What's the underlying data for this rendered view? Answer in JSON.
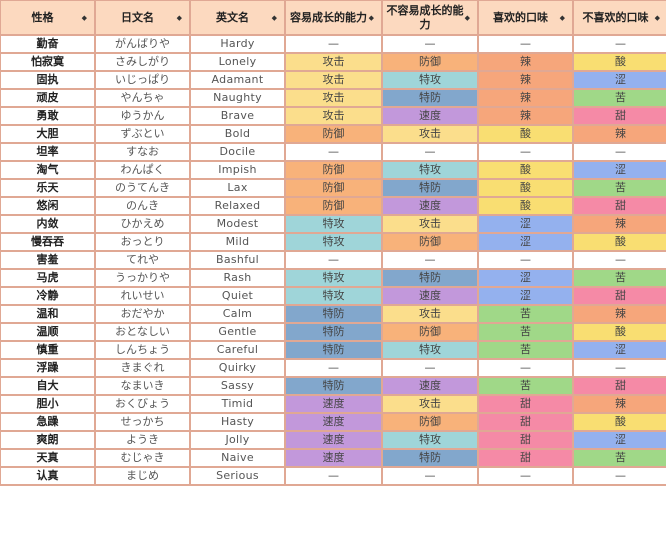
{
  "table": {
    "headers": [
      {
        "label": "性格",
        "sort_icon": "sort-diamond-icon"
      },
      {
        "label": "日文名",
        "sort_icon": "sort-diamond-icon"
      },
      {
        "label": "英文名",
        "sort_icon": "sort-diamond-icon"
      },
      {
        "label": "容易成长的能力",
        "sort_icon": "sort-diamond-icon"
      },
      {
        "label": "不容易成长的能力",
        "sort_icon": "sort-diamond-icon"
      },
      {
        "label": "喜欢的口味",
        "sort_icon": "sort-diamond-icon"
      },
      {
        "label": "不喜欢的口味",
        "sort_icon": "sort-diamond-icon"
      }
    ],
    "rows": [
      {
        "nature": "勤奋",
        "jp": "がんばりや",
        "en": "Hardy",
        "up": "—",
        "down": "—",
        "like": "—",
        "dislike": "—"
      },
      {
        "nature": "怕寂寞",
        "jp": "さみしがり",
        "en": "Lonely",
        "up": "攻击",
        "down": "防御",
        "like": "辣",
        "dislike": "酸"
      },
      {
        "nature": "固执",
        "jp": "いじっぱり",
        "en": "Adamant",
        "up": "攻击",
        "down": "特攻",
        "like": "辣",
        "dislike": "涩"
      },
      {
        "nature": "顽皮",
        "jp": "やんちゃ",
        "en": "Naughty",
        "up": "攻击",
        "down": "特防",
        "like": "辣",
        "dislike": "苦"
      },
      {
        "nature": "勇敢",
        "jp": "ゆうかん",
        "en": "Brave",
        "up": "攻击",
        "down": "速度",
        "like": "辣",
        "dislike": "甜"
      },
      {
        "nature": "大胆",
        "jp": "ずぶとい",
        "en": "Bold",
        "up": "防御",
        "down": "攻击",
        "like": "酸",
        "dislike": "辣"
      },
      {
        "nature": "坦率",
        "jp": "すなお",
        "en": "Docile",
        "up": "—",
        "down": "—",
        "like": "—",
        "dislike": "—"
      },
      {
        "nature": "淘气",
        "jp": "わんぱく",
        "en": "Impish",
        "up": "防御",
        "down": "特攻",
        "like": "酸",
        "dislike": "涩"
      },
      {
        "nature": "乐天",
        "jp": "のうてんき",
        "en": "Lax",
        "up": "防御",
        "down": "特防",
        "like": "酸",
        "dislike": "苦"
      },
      {
        "nature": "悠闲",
        "jp": "のんき",
        "en": "Relaxed",
        "up": "防御",
        "down": "速度",
        "like": "酸",
        "dislike": "甜"
      },
      {
        "nature": "内敛",
        "jp": "ひかえめ",
        "en": "Modest",
        "up": "特攻",
        "down": "攻击",
        "like": "涩",
        "dislike": "辣"
      },
      {
        "nature": "慢吞吞",
        "jp": "おっとり",
        "en": "Mild",
        "up": "特攻",
        "down": "防御",
        "like": "涩",
        "dislike": "酸"
      },
      {
        "nature": "害羞",
        "jp": "てれや",
        "en": "Bashful",
        "up": "—",
        "down": "—",
        "like": "—",
        "dislike": "—"
      },
      {
        "nature": "马虎",
        "jp": "うっかりや",
        "en": "Rash",
        "up": "特攻",
        "down": "特防",
        "like": "涩",
        "dislike": "苦"
      },
      {
        "nature": "冷静",
        "jp": "れいせい",
        "en": "Quiet",
        "up": "特攻",
        "down": "速度",
        "like": "涩",
        "dislike": "甜"
      },
      {
        "nature": "温和",
        "jp": "おだやか",
        "en": "Calm",
        "up": "特防",
        "down": "攻击",
        "like": "苦",
        "dislike": "辣"
      },
      {
        "nature": "温顺",
        "jp": "おとなしい",
        "en": "Gentle",
        "up": "特防",
        "down": "防御",
        "like": "苦",
        "dislike": "酸"
      },
      {
        "nature": "慎重",
        "jp": "しんちょう",
        "en": "Careful",
        "up": "特防",
        "down": "特攻",
        "like": "苦",
        "dislike": "涩"
      },
      {
        "nature": "浮躁",
        "jp": "きまぐれ",
        "en": "Quirky",
        "up": "—",
        "down": "—",
        "like": "—",
        "dislike": "—"
      },
      {
        "nature": "自大",
        "jp": "なまいき",
        "en": "Sassy",
        "up": "特防",
        "down": "速度",
        "like": "苦",
        "dislike": "甜"
      },
      {
        "nature": "胆小",
        "jp": "おくびょう",
        "en": "Timid",
        "up": "速度",
        "down": "攻击",
        "like": "甜",
        "dislike": "辣"
      },
      {
        "nature": "急躁",
        "jp": "せっかち",
        "en": "Hasty",
        "up": "速度",
        "down": "防御",
        "like": "甜",
        "dislike": "酸"
      },
      {
        "nature": "爽朗",
        "jp": "ようき",
        "en": "Jolly",
        "up": "速度",
        "down": "特攻",
        "like": "甜",
        "dislike": "涩"
      },
      {
        "nature": "天真",
        "jp": "むじゃき",
        "en": "Naive",
        "up": "速度",
        "down": "特防",
        "like": "甜",
        "dislike": "苦"
      },
      {
        "nature": "认真",
        "jp": "まじめ",
        "en": "Serious",
        "up": "—",
        "down": "—",
        "like": "—",
        "dislike": "—"
      }
    ]
  },
  "colors": {
    "header_bg": "#fcd9bf",
    "border": "#e0a894",
    "stat": {
      "攻击": "#fbde8c",
      "防御": "#f8b27a",
      "特攻": "#9fd5d9",
      "特防": "#82a7cc",
      "速度": "#c298db",
      "—": "#ffffff"
    },
    "flavor": {
      "辣": "#f6a67b",
      "酸": "#f9de72",
      "涩": "#94b1ee",
      "苦": "#a0d888",
      "甜": "#f58aa6",
      "—": "#ffffff"
    }
  }
}
